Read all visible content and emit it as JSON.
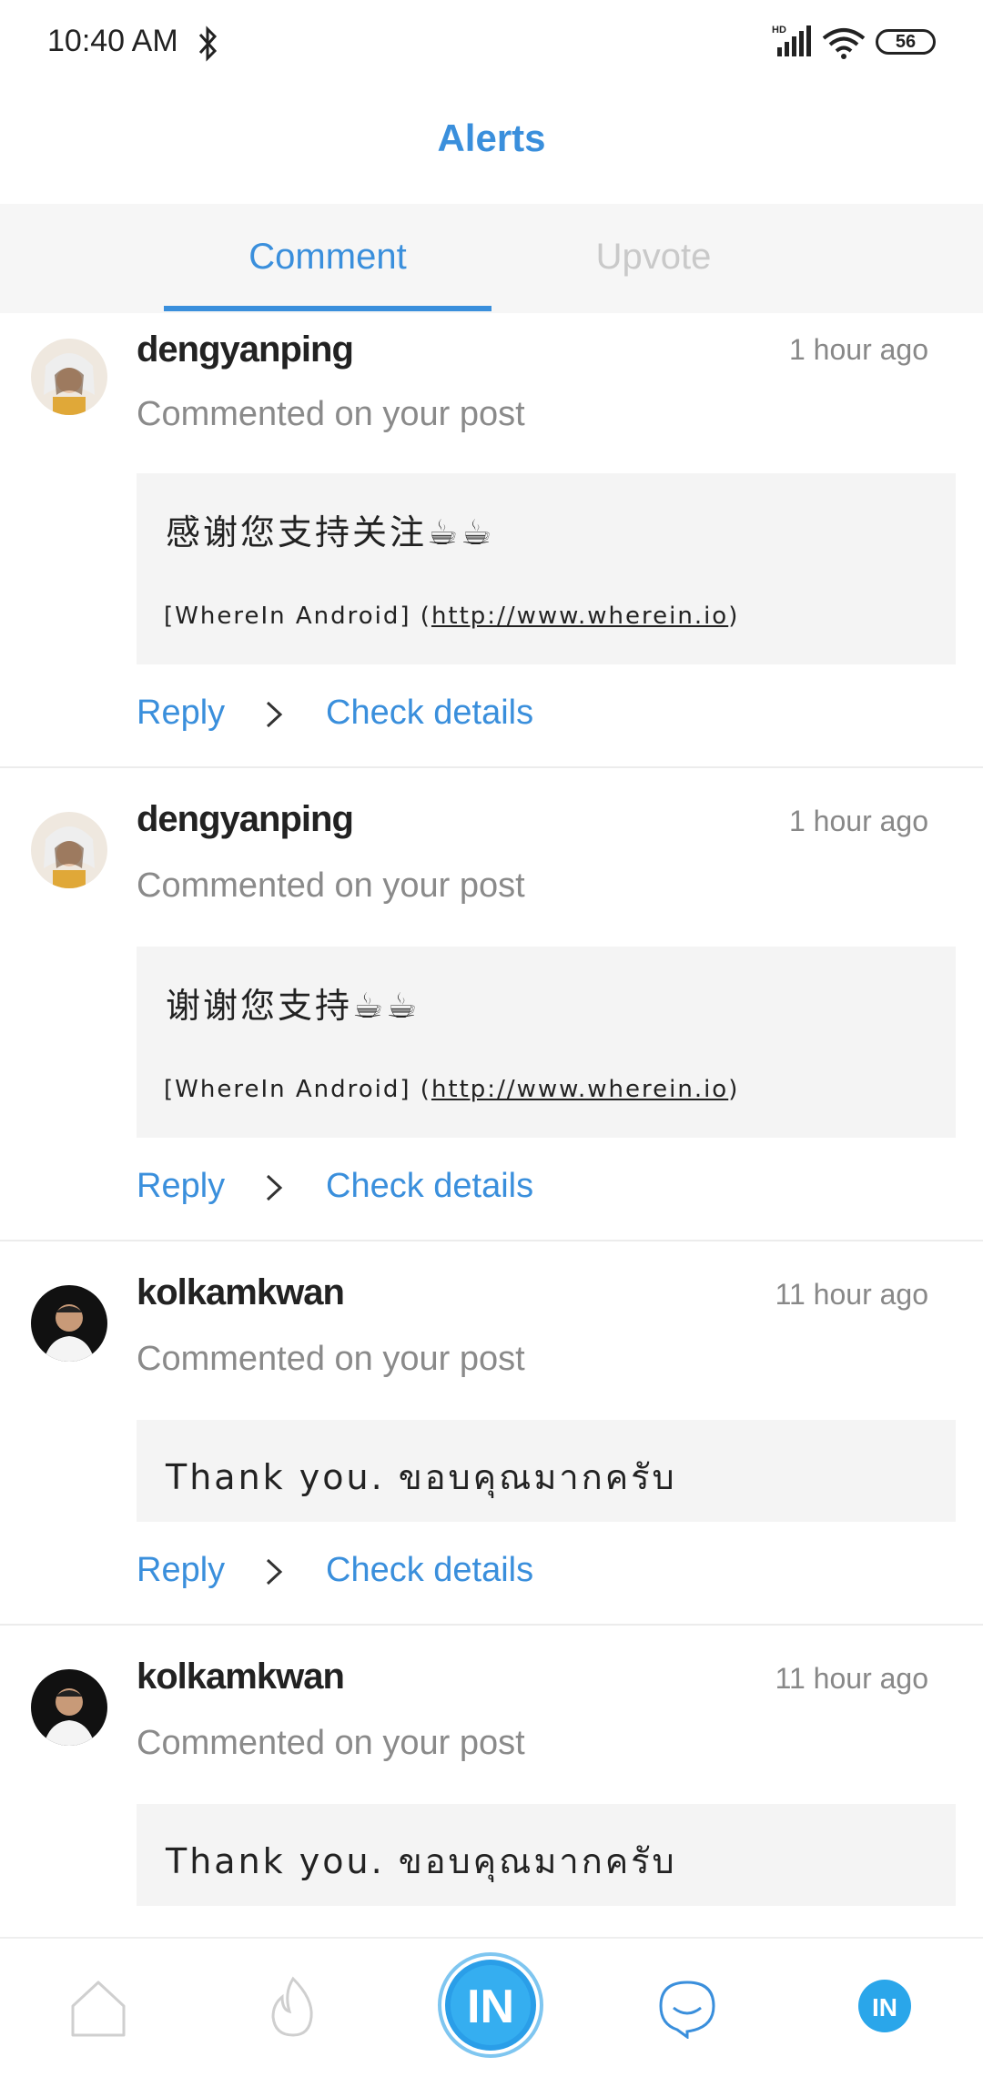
{
  "status_bar": {
    "time": "10:40 AM",
    "battery": "56",
    "network": "HD"
  },
  "header": {
    "title": "Alerts"
  },
  "tabs": [
    {
      "label": "Comment",
      "active": true
    },
    {
      "label": "Upvote",
      "active": false
    }
  ],
  "colors": {
    "accent": "#3a8fdc",
    "inactive_tab": "#c9c9c9",
    "box_bg": "#f4f4f4"
  },
  "alerts": [
    {
      "username": "dengyanping",
      "time": "1 hour ago",
      "subtitle": "Commented on your post",
      "comment": "感谢您支持关注☕☕",
      "source_prefix": "[WhereIn Android] (",
      "source_link": "http://www.wherein.io",
      "source_suffix": ")",
      "reply_label": "Reply",
      "details_label": "Check details"
    },
    {
      "username": "dengyanping",
      "time": "1 hour ago",
      "subtitle": "Commented on your post",
      "comment": "谢谢您支持☕☕",
      "source_prefix": "[WhereIn Android] (",
      "source_link": "http://www.wherein.io",
      "source_suffix": ")",
      "reply_label": "Reply",
      "details_label": "Check details"
    },
    {
      "username": "kolkamkwan",
      "time": "11 hour ago",
      "subtitle": "Commented on your post",
      "comment": "Thank you. ขอบคุณมากครับ",
      "reply_label": "Reply",
      "details_label": "Check details"
    },
    {
      "username": "kolkamkwan",
      "time": "11 hour ago",
      "subtitle": "Commented on your post",
      "comment": "Thank you. ขอบคุณมากครับ"
    }
  ],
  "bottom_nav": [
    {
      "icon": "home-icon"
    },
    {
      "icon": "flame-icon"
    },
    {
      "icon": "wherein-logo",
      "text": "IN"
    },
    {
      "icon": "message-icon"
    },
    {
      "icon": "profile-icon",
      "text": "IN"
    }
  ]
}
